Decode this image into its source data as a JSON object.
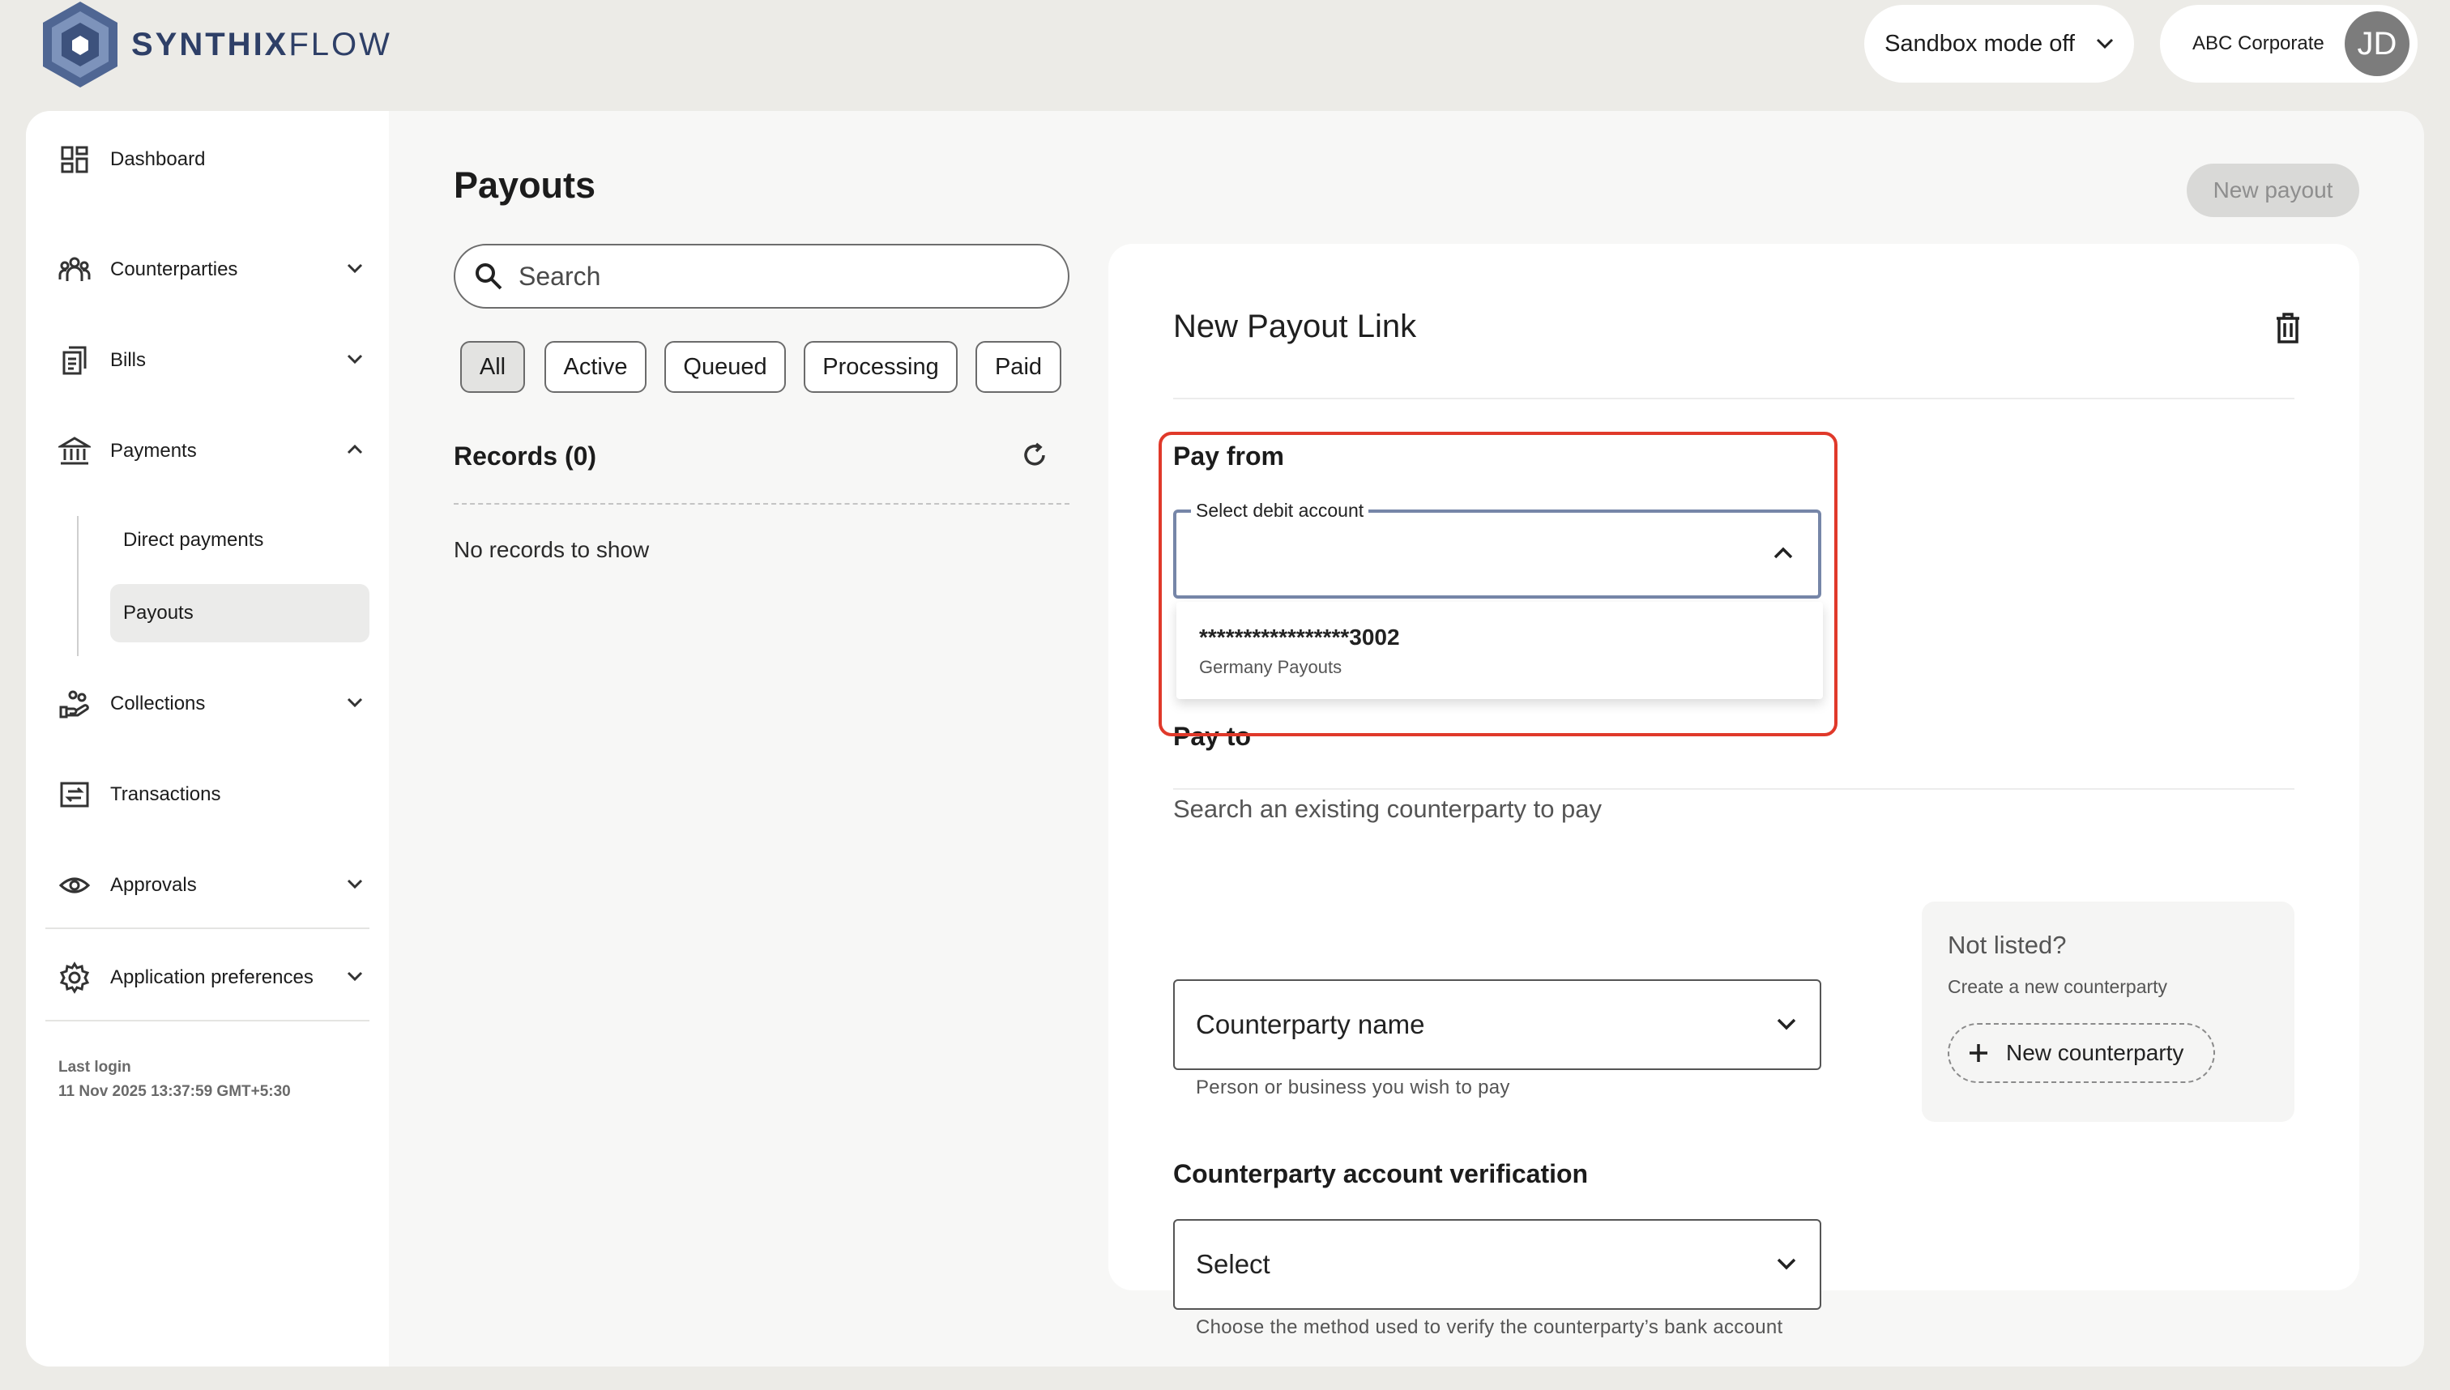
{
  "brand": {
    "name_bold": "SYNTHIX",
    "name_light": "FLOW"
  },
  "header": {
    "sandbox_label": "Sandbox mode off",
    "account_name": "ABC Corporate",
    "avatar_initials": "JD"
  },
  "sidebar": {
    "items": [
      {
        "label": "Dashboard",
        "icon": "dashboard-icon"
      },
      {
        "label": "Counterparties",
        "icon": "users-icon"
      },
      {
        "label": "Bills",
        "icon": "bills-icon"
      },
      {
        "label": "Payments",
        "icon": "bank-icon"
      },
      {
        "label": "Collections",
        "icon": "hand-coins-icon"
      },
      {
        "label": "Transactions",
        "icon": "transfer-icon"
      },
      {
        "label": "Approvals",
        "icon": "eye-icon"
      },
      {
        "label": "Application preferences",
        "icon": "gear-icon"
      }
    ],
    "payments_sub": [
      "Direct payments",
      "Payouts"
    ],
    "last_login_label": "Last login",
    "last_login_value": "11 Nov 2025 13:37:59 GMT+5:30"
  },
  "main": {
    "title": "Payouts",
    "new_payout_label": "New payout",
    "search_placeholder": "Search",
    "filters": [
      "All",
      "Active",
      "Queued",
      "Processing",
      "Paid"
    ],
    "selected_filter": "All",
    "records_label": "Records (0)",
    "empty_text": "No records to show"
  },
  "form": {
    "title": "New Payout Link",
    "pay_from_label": "Pay from",
    "debit_account_label": "Select debit account",
    "dropdown_options": [
      {
        "account": "*****************3002",
        "name": "Germany Payouts"
      }
    ],
    "pay_to_label": "Pay to",
    "pay_to_hint": "Search an existing counterparty to pay",
    "counterparty_placeholder": "Counterparty name",
    "counterparty_help": "Person or business you wish to pay",
    "verification_label": "Counterparty account verification",
    "verification_placeholder": "Select",
    "verification_help": "Choose the method used to verify the counterparty’s bank account",
    "not_listed_title": "Not listed?",
    "not_listed_sub": "Create a new counterparty",
    "new_counterparty_label": "New counterparty"
  },
  "colors": {
    "brand": "#2e3f67",
    "highlight": "#e0392a",
    "focus_border": "#7686a8"
  }
}
